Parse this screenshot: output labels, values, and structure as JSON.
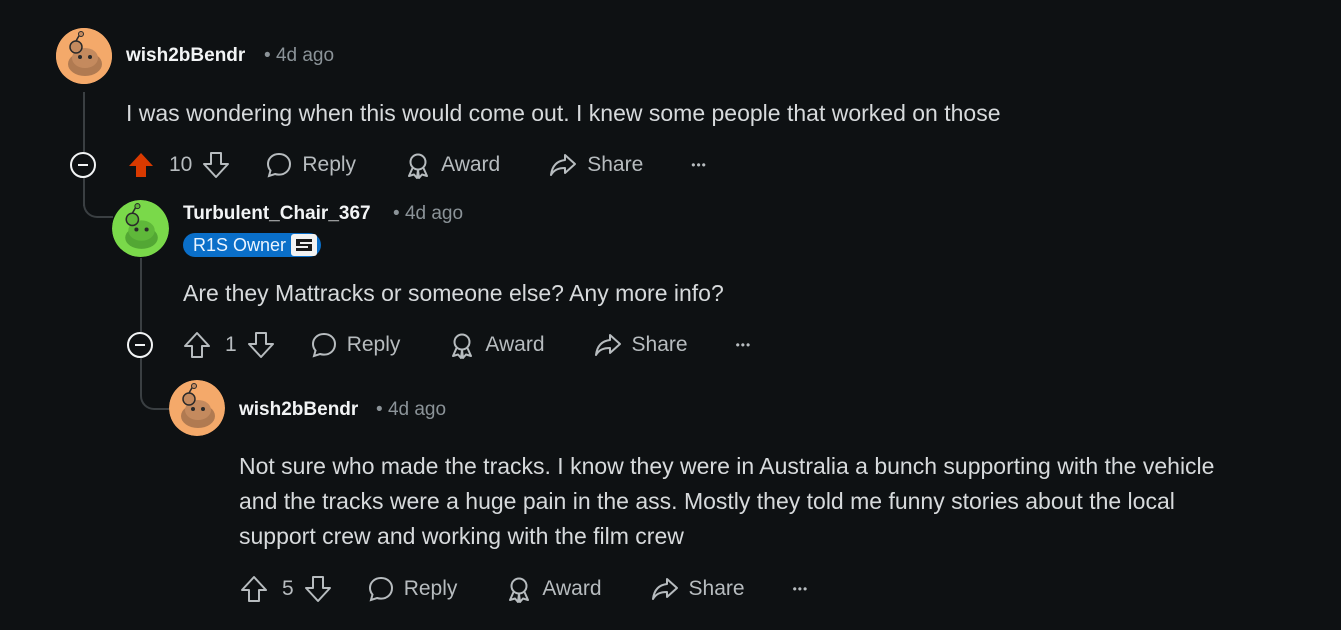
{
  "comments": [
    {
      "author": "wish2bBendr",
      "sep": "•",
      "time": "4d ago",
      "body": "I was wondering when this would come out. I knew some people that worked on those",
      "score": "10",
      "upvoted": true,
      "reply_label": "Reply",
      "award_label": "Award",
      "share_label": "Share",
      "more_label": "•••"
    },
    {
      "author": "Turbulent_Chair_367",
      "sep": "•",
      "time": "4d ago",
      "flair": "R1S Owner",
      "body": "Are they Mattracks or someone else? Any more info?",
      "score": "1",
      "upvoted": false,
      "reply_label": "Reply",
      "award_label": "Award",
      "share_label": "Share",
      "more_label": "•••"
    },
    {
      "author": "wish2bBendr",
      "sep": "•",
      "time": "4d ago",
      "body_lines": [
        "Not sure who made the tracks. I know they were in Australia a bunch supporting with the vehicle",
        "and the tracks were a huge pain in the ass. Mostly they told me funny stories about the local",
        "support crew and working with the film crew"
      ],
      "score": "5",
      "upvoted": false,
      "reply_label": "Reply",
      "award_label": "Award",
      "share_label": "Share",
      "more_label": "•••"
    }
  ],
  "colors": {
    "background": "#0e1113",
    "upvote_active": "#d93a00",
    "flair_bg": "#0a6fc9",
    "avatar_orange": "#f4a96a",
    "avatar_green": "#7ad94a"
  }
}
